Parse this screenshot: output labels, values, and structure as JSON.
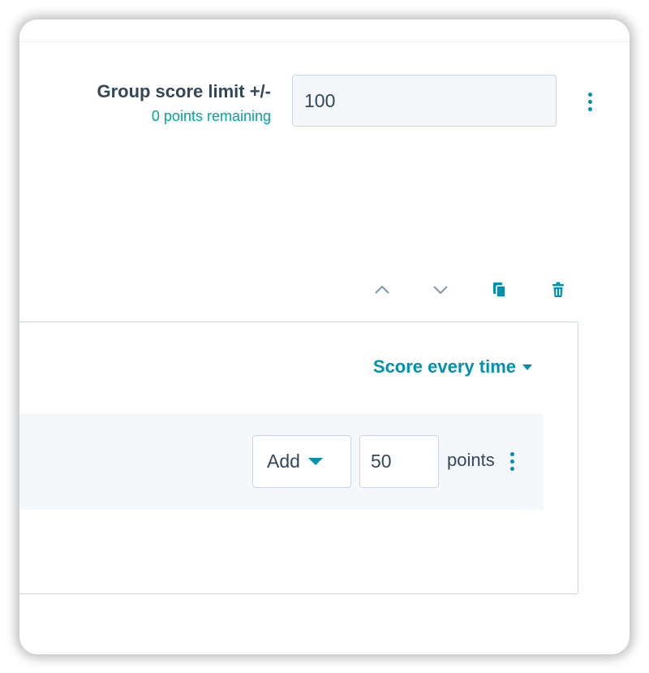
{
  "group": {
    "title": "Group score limit +/-",
    "remaining": "0 points remaining",
    "limit_value": "100"
  },
  "criteria": {
    "frequency_label": "Score every time",
    "action_value": "Add",
    "points_value": "50",
    "points_unit": "points"
  },
  "icons": {
    "move_up": "chevron-up-icon",
    "move_down": "chevron-down-icon",
    "clone": "copy-icon",
    "delete": "trash-icon",
    "more": "more-vertical-icon"
  },
  "colors": {
    "accent": "#0091ae",
    "success": "#00a4a0",
    "text": "#33475b",
    "border": "#cbd6e2"
  }
}
